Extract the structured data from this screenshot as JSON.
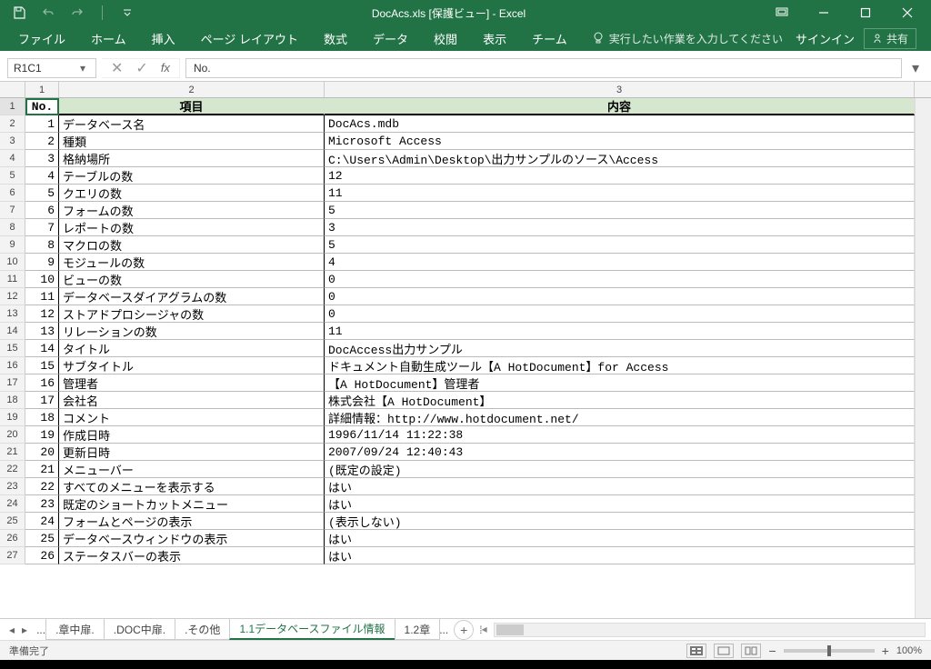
{
  "titlebar": {
    "title": "DocAcs.xls [保護ビュー] - Excel"
  },
  "ribbon": {
    "tabs": [
      "ファイル",
      "ホーム",
      "挿入",
      "ページ レイアウト",
      "数式",
      "データ",
      "校閲",
      "表示",
      "チーム"
    ],
    "tell_me": "実行したい作業を入力してください",
    "signin": "サインイン",
    "share": "共有"
  },
  "formula": {
    "name_box": "R1C1",
    "value": "No."
  },
  "grid": {
    "col_numbers": [
      "1",
      "2",
      "3"
    ],
    "header_cells": [
      "No.",
      "項目",
      "内容"
    ],
    "rows": [
      {
        "n": "1",
        "item": "データベース名",
        "content": "DocAcs.mdb"
      },
      {
        "n": "2",
        "item": "種類",
        "content": "Microsoft Access"
      },
      {
        "n": "3",
        "item": "格納場所",
        "content": "C:\\Users\\Admin\\Desktop\\出力サンプルのソース\\Access"
      },
      {
        "n": "4",
        "item": "テーブルの数",
        "content": "12"
      },
      {
        "n": "5",
        "item": "クエリの数",
        "content": "11"
      },
      {
        "n": "6",
        "item": "フォームの数",
        "content": "5"
      },
      {
        "n": "7",
        "item": "レポートの数",
        "content": "3"
      },
      {
        "n": "8",
        "item": "マクロの数",
        "content": "5"
      },
      {
        "n": "9",
        "item": "モジュールの数",
        "content": "4"
      },
      {
        "n": "10",
        "item": "ビューの数",
        "content": "0"
      },
      {
        "n": "11",
        "item": "データベースダイアグラムの数",
        "content": "0"
      },
      {
        "n": "12",
        "item": "ストアドプロシージャの数",
        "content": "0"
      },
      {
        "n": "13",
        "item": "リレーションの数",
        "content": "11"
      },
      {
        "n": "14",
        "item": "タイトル",
        "content": "DocAccess出力サンプル"
      },
      {
        "n": "15",
        "item": "サブタイトル",
        "content": "ドキュメント自動生成ツール【A HotDocument】for Access"
      },
      {
        "n": "16",
        "item": "管理者",
        "content": "【A HotDocument】管理者"
      },
      {
        "n": "17",
        "item": "会社名",
        "content": "株式会社【A HotDocument】"
      },
      {
        "n": "18",
        "item": "コメント",
        "content": "詳細情報：http://www.hotdocument.net/"
      },
      {
        "n": "19",
        "item": "作成日時",
        "content": "1996/11/14 11:22:38"
      },
      {
        "n": "20",
        "item": "更新日時",
        "content": "2007/09/24 12:40:43"
      },
      {
        "n": "21",
        "item": "メニューバー",
        "content": "(既定の設定)"
      },
      {
        "n": "22",
        "item": "すべてのメニューを表示する",
        "content": "はい"
      },
      {
        "n": "23",
        "item": "既定のショートカットメニュー",
        "content": "はい"
      },
      {
        "n": "24",
        "item": "フォームとページの表示",
        "content": "(表示しない)"
      },
      {
        "n": "25",
        "item": "データベースウィンドウの表示",
        "content": "はい"
      },
      {
        "n": "26",
        "item": "ステータスバーの表示",
        "content": "はい"
      }
    ]
  },
  "tabs": {
    "left_dots": "...",
    "sheets": [
      ".章中扉.",
      ".DOC中扉.",
      ".その他",
      "1.1データベースファイル情報",
      "1.2章"
    ],
    "active_index": 3,
    "trailing_dots": "..."
  },
  "status": {
    "left": "準備完了",
    "zoom": "100%"
  }
}
